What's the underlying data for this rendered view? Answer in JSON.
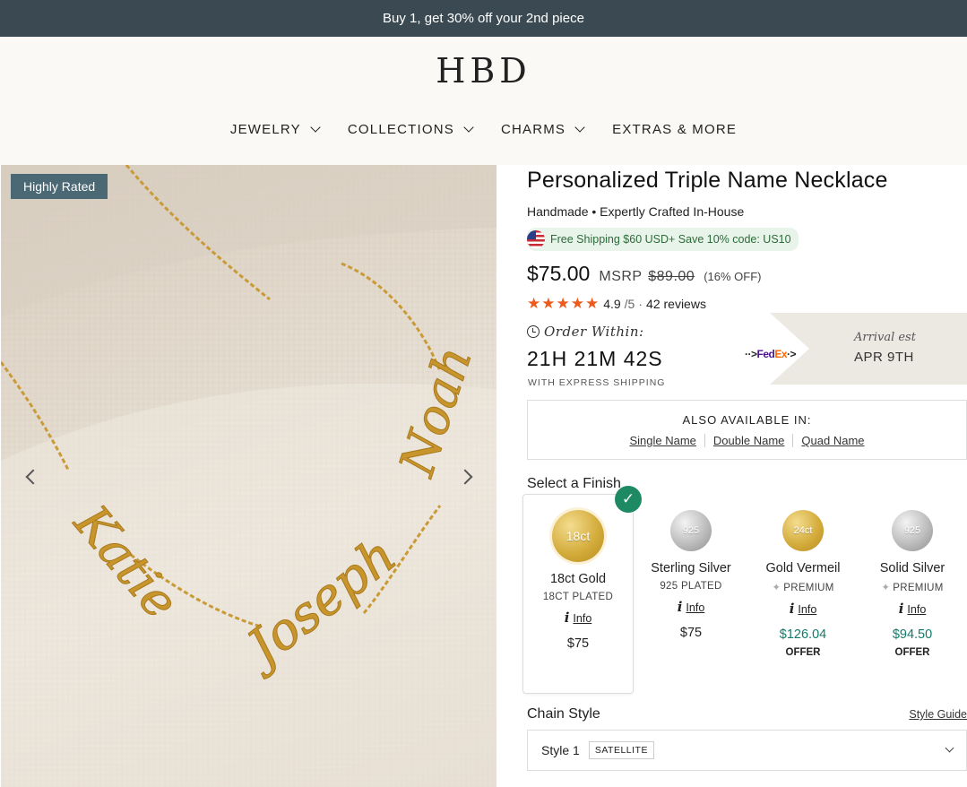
{
  "promo": {
    "text": "Buy 1, get 30% off your 2nd piece"
  },
  "brand": {
    "logo_text": "HBD"
  },
  "nav": {
    "items": [
      {
        "label": "JEWELRY",
        "has_dropdown": true
      },
      {
        "label": "COLLECTIONS",
        "has_dropdown": true
      },
      {
        "label": "CHARMS",
        "has_dropdown": true
      },
      {
        "label": "EXTRAS & MORE",
        "has_dropdown": false
      }
    ]
  },
  "gallery": {
    "badge": "Highly Rated",
    "names": [
      "Katie",
      "Joseph",
      "Noah"
    ]
  },
  "product": {
    "title": "Personalized Triple Name Necklace",
    "subtitle": "Handmade • Expertly Crafted In-House",
    "shipping_badge": "Free Shipping $60 USD+ Save 10% code: US10",
    "price": "$75.00",
    "msrp_label": "MSRP",
    "msrp_value": "$89.00",
    "discount": "(16% OFF)",
    "rating": {
      "stars": "★★★★★",
      "score": "4.9",
      "out_of": "/5",
      "separator": "·",
      "reviews": "42 reviews"
    },
    "order": {
      "label": "Order Within:",
      "countdown": "21H 21M 42S",
      "note": "WITH EXPRESS SHIPPING",
      "carrier_prefix": "··>",
      "carrier_fe": "Fed",
      "carrier_ex": "Ex",
      "carrier_suffix": "·>",
      "arrival_label": "Arrival est",
      "arrival_date": "APR 9TH"
    },
    "also_available": {
      "heading": "ALSO AVAILABLE IN:",
      "links": [
        "Single Name",
        "Double Name",
        "Quad Name"
      ]
    },
    "finish": {
      "heading": "Select a Finish",
      "check": "✓",
      "options": [
        {
          "coin": "18ct",
          "name": "18ct Gold",
          "sub": "18CT PLATED",
          "info_i": "i",
          "info": "Info",
          "price": "$75",
          "offer": "",
          "selected": true
        },
        {
          "coin": "925",
          "name": "Sterling Silver",
          "sub": "925 PLATED",
          "info_i": "i",
          "info": "Info",
          "price": "$75",
          "offer": "",
          "selected": false
        },
        {
          "coin": "24ct",
          "name": "Gold Vermeil",
          "sub": "PREMIUM",
          "info_i": "i",
          "info": "Info",
          "price": "$126.04",
          "offer": "OFFER",
          "selected": false
        },
        {
          "coin": "925",
          "name": "Solid Silver",
          "sub": "PREMIUM",
          "info_i": "i",
          "info": "Info",
          "price": "$94.50",
          "offer": "OFFER",
          "selected": false
        }
      ]
    },
    "chain": {
      "heading": "Chain Style",
      "guide": "Style Guide",
      "selected": "Style 1",
      "tag": "SATELLITE"
    }
  },
  "colors": {
    "promo_bg": "#3b4a52",
    "badge_bg": "#4a6975",
    "star": "#ee5a1c",
    "check": "#1e8a63",
    "offer_price": "#127a6a"
  }
}
